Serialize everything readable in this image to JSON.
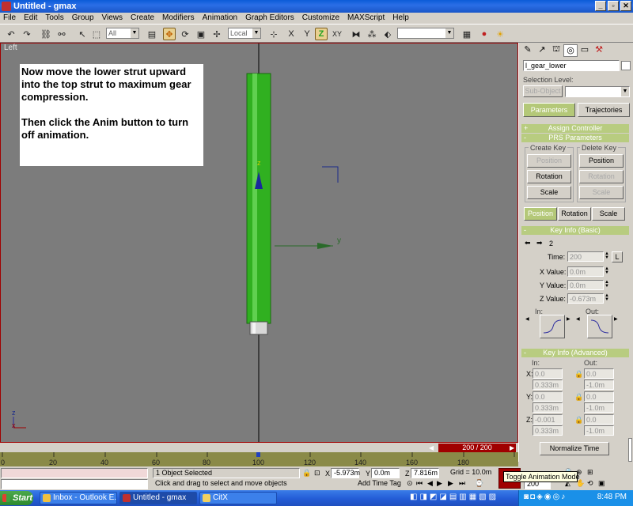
{
  "window": {
    "title": "Untitled - gmax"
  },
  "menu": [
    "File",
    "Edit",
    "Tools",
    "Group",
    "Views",
    "Create",
    "Modifiers",
    "Animation",
    "Graph Editors",
    "Customize",
    "MAXScript",
    "Help"
  ],
  "toolbar": {
    "selection_filter": "All",
    "coord_system": "Local",
    "axis_labels": [
      "X",
      "Y",
      "Z",
      "XY"
    ]
  },
  "viewport": {
    "label": "Left",
    "instruction_lines": [
      "Now move the lower strut upward into the top strut to maximum gear compression.",
      "Then click the Anim button to turn off animation."
    ],
    "axis_y_label": "y",
    "axis_z_label": "z",
    "mini_axis_z": "z",
    "mini_axis_x": "x"
  },
  "command_panel": {
    "object_name": "l_gear_lower",
    "selection_level_label": "Selection Level:",
    "sub_object_label": "Sub-Object",
    "parameters_tab": "Parameters",
    "trajectories_tab": "Trajectories",
    "assign_controller": "Assign Controller",
    "prs_parameters": "PRS Parameters",
    "create_key_label": "Create Key",
    "delete_key_label": "Delete Key",
    "create_keys": [
      "Position",
      "Rotation",
      "Scale"
    ],
    "delete_keys": [
      "Position",
      "Rotation",
      "Scale"
    ],
    "prs_tabs": [
      "Position",
      "Rotation",
      "Scale"
    ],
    "key_info_basic": "Key Info (Basic)",
    "key_number": "2",
    "time_label": "Time:",
    "time_value": "200",
    "lock_label": "L",
    "xvalue_label": "X Value:",
    "xvalue": "0.0m",
    "yvalue_label": "Y Value:",
    "yvalue": "0.0m",
    "zvalue_label": "Z Value:",
    "zvalue": "-0.673m",
    "in_label": "In:",
    "out_label": "Out:",
    "key_info_advanced": "Key Info (Advanced)",
    "adv_in": "In:",
    "adv_out": "Out:",
    "adv_rows": [
      {
        "axis": "X:",
        "in": "0.0",
        "in2": "0.333m",
        "out": "0.0",
        "out2": "-1.0m"
      },
      {
        "axis": "Y:",
        "in": "0.0",
        "in2": "0.333m",
        "out": "0.0",
        "out2": "-1.0m"
      },
      {
        "axis": "Z:",
        "in": "-0.001",
        "in2": "0.333m",
        "out": "0.0",
        "out2": "-1.0m"
      }
    ],
    "normalize_time": "Normalize Time"
  },
  "timeline": {
    "slider_text": "200 / 200",
    "ticks": [
      "0",
      "20",
      "40",
      "60",
      "80",
      "100",
      "120",
      "140",
      "160",
      "180"
    ]
  },
  "status": {
    "selected": "1 Object Selected",
    "prompt": "Click and drag to select and move objects",
    "x_label": "X",
    "x_value": "-5.973m",
    "y_label": "Y",
    "y_value": "0.0m",
    "z_label": "Z",
    "z_value": "7.816m",
    "grid": "Grid = 10.0m",
    "add_time_tag": "Add Time Tag",
    "tooltip": "Toggle Animation Mode",
    "frame_value": "200"
  },
  "taskbar": {
    "start": "Start",
    "tasks": [
      "Inbox - Outlook E...",
      "Untitled - gmax",
      "CitX"
    ],
    "clock": "8:48 PM"
  },
  "colors": {
    "accent": "#b8cc80",
    "anim_red": "#a00000",
    "strut_green": "#30b020"
  }
}
